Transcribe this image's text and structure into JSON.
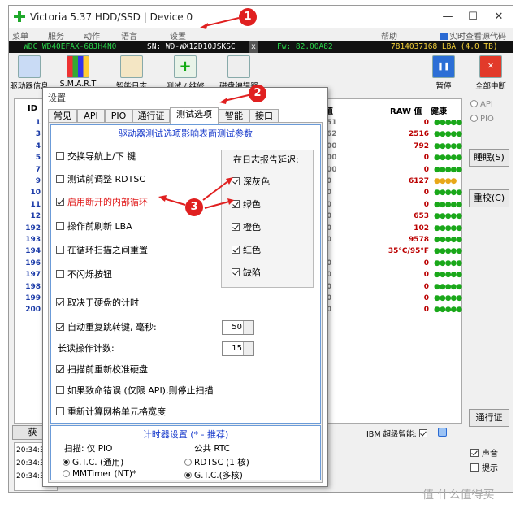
{
  "window": {
    "title": "Victoria 5.37 HDD/SSD | Device 0"
  },
  "menu": [
    "菜单",
    "服务",
    "动作",
    "语言",
    "设置",
    "帮助"
  ],
  "menu_right": "实时查看源代码",
  "drive": {
    "model": "WDC WD40EFAX-68JH4N0",
    "serial": "SN: WD-WX12D10JSKSC",
    "close": "x",
    "firmware": "Fw: 82.00A82",
    "lba": "7814037168 LBA (4.0 TB)"
  },
  "toolbar": {
    "drive_info": "驱动器信息",
    "smart": "S.M.A.R.T",
    "smart_log": "智能日志",
    "test_repair": "测试 / 维修",
    "disk_editor": "磁盘编辑器",
    "pause": "暂停",
    "stop_all": "全部中断"
  },
  "table": {
    "headers": [
      "ID",
      "值",
      "RAW 值",
      "健康"
    ],
    "rows": [
      {
        "id": "1",
        "val": "51",
        "raw": "0",
        "health": "●●●●●"
      },
      {
        "id": "3",
        "val": "62",
        "raw": "2516",
        "health": "●●●●●"
      },
      {
        "id": "4",
        "val": "00",
        "raw": "792",
        "health": "●●●●●"
      },
      {
        "id": "5",
        "val": "00",
        "raw": "0",
        "health": "●●●●●"
      },
      {
        "id": "7",
        "val": "00",
        "raw": "0",
        "health": "●●●●●"
      },
      {
        "id": "9",
        "val": "0",
        "raw": "6127",
        "health": "●●●●"
      },
      {
        "id": "10",
        "val": "0",
        "raw": "0",
        "health": "●●●●●"
      },
      {
        "id": "11",
        "val": "0",
        "raw": "0",
        "health": "●●●●●"
      },
      {
        "id": "12",
        "val": "0",
        "raw": "653",
        "health": "●●●●●"
      },
      {
        "id": "192",
        "val": "0",
        "raw": "102",
        "health": "●●●●●"
      },
      {
        "id": "193",
        "val": "0",
        "raw": "9578",
        "health": "●●●●●"
      },
      {
        "id": "194",
        "val": "",
        "raw": "35°C/95°F",
        "health": "●●●●●"
      },
      {
        "id": "196",
        "val": "0",
        "raw": "0",
        "health": "●●●●●"
      },
      {
        "id": "197",
        "val": "0",
        "raw": "0",
        "health": "●●●●●"
      },
      {
        "id": "198",
        "val": "0",
        "raw": "0",
        "health": "●●●●●"
      },
      {
        "id": "199",
        "val": "0",
        "raw": "0",
        "health": "●●●●●"
      },
      {
        "id": "200",
        "val": "0",
        "raw": "0",
        "health": "●●●●●"
      }
    ]
  },
  "right": {
    "api": "API",
    "pio": "PIO",
    "sleep": "睡眠(S)",
    "recalibrate": "重校(C)",
    "passport": "通行证",
    "sound": "声音",
    "hint": "提示"
  },
  "bottom": {
    "get": "获",
    "ibm": "IBM 超级智能:",
    "log": [
      "20:34:39",
      "20:34:39",
      "20:34:39"
    ]
  },
  "dialog": {
    "title": "设置",
    "tabs": [
      "常见",
      "API",
      "PIO",
      "通行证",
      "测试选项",
      "智能",
      "接口"
    ],
    "group_title": "驱动器测试选项影响表面测试参数",
    "options": [
      {
        "label": "交换导航上/下 键",
        "checked": false
      },
      {
        "label": "测试前调整 RDTSC",
        "checked": false
      },
      {
        "label": "启用断开的内部循环",
        "checked": true
      },
      {
        "label": "操作前刷新 LBA",
        "checked": false
      },
      {
        "label": "在循环扫描之间重置",
        "checked": false
      },
      {
        "label": "不闪烁按钮",
        "checked": false
      },
      {
        "label": "取决于硬盘的计时",
        "checked": true
      },
      {
        "label": "自动重复跳转键, 毫秒:",
        "checked": true
      },
      {
        "label": "长读操作计数:",
        "checked": null
      },
      {
        "label": "扫描前重新校准硬盘",
        "checked": true
      },
      {
        "label": "如果致命错误 (仅限 API),则停止扫描",
        "checked": false
      },
      {
        "label": "重新计算网格单元格宽度",
        "checked": false
      }
    ],
    "autorepeat_ms": "50",
    "long_read_count": "15",
    "delay_log": {
      "title": "在日志报告延迟:",
      "items": [
        {
          "label": "深灰色",
          "checked": true
        },
        {
          "label": "绿色",
          "checked": true
        },
        {
          "label": "橙色",
          "checked": true
        },
        {
          "label": "红色",
          "checked": true
        },
        {
          "label": "缺陷",
          "checked": true
        }
      ]
    },
    "timer": {
      "title": "计时器设置 (* - 推荐)",
      "scan_label": "扫描: 仅 PIO",
      "public_label": "公共 RTC",
      "scan_opts": [
        {
          "label": "G.T.C. (通用)",
          "on": true
        },
        {
          "label": "MMTimer (NT)*",
          "on": false
        }
      ],
      "public_opts": [
        {
          "label": "RDTSC (1 核)",
          "on": false
        },
        {
          "label": "G.T.C.(多核)",
          "on": true
        }
      ]
    }
  },
  "markers": [
    "1",
    "2",
    "3"
  ],
  "watermark": "值 什么值得买"
}
